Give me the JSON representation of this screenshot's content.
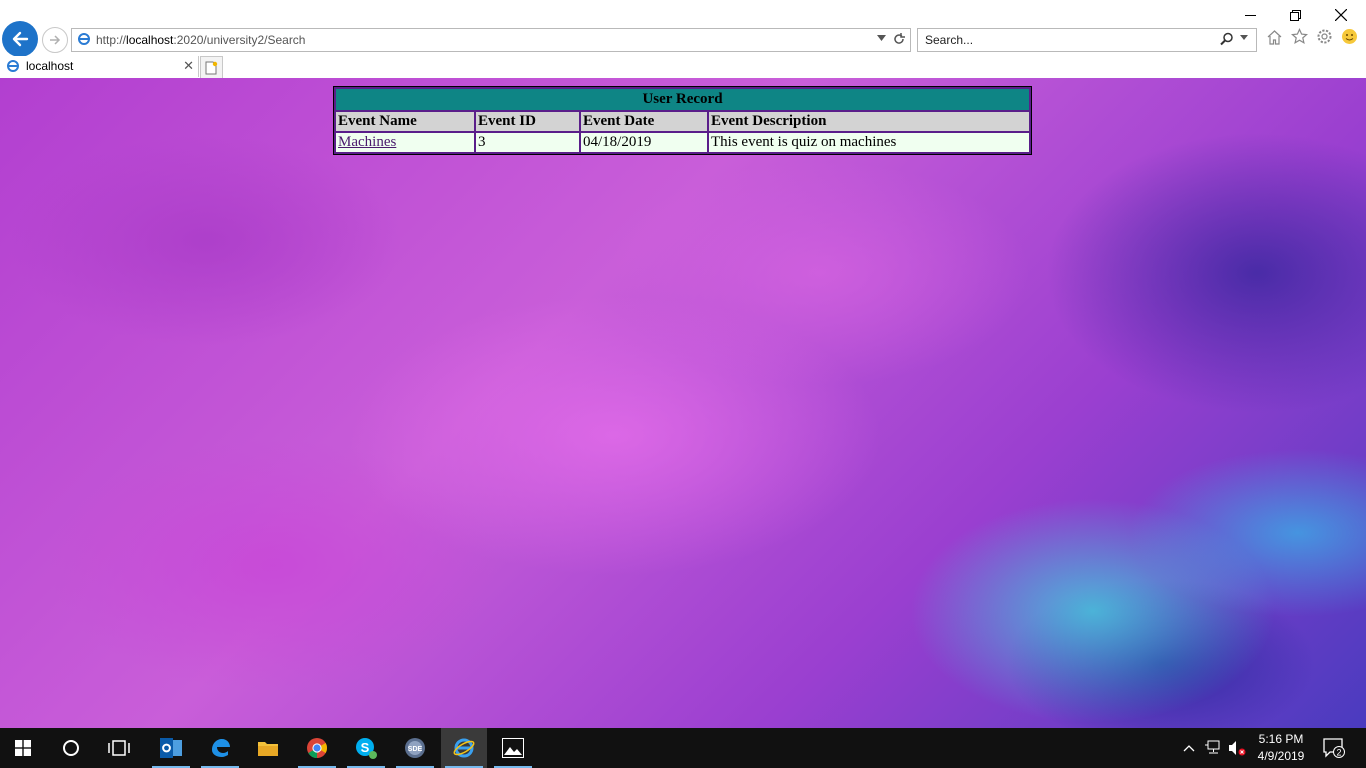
{
  "browser": {
    "url_prefix": "http://",
    "url_host": "localhost",
    "url_rest": ":2020/university2/Search",
    "search_placeholder": "Search...",
    "tab_title": "localhost"
  },
  "table": {
    "caption": "User Record",
    "headers": [
      "Event Name",
      "Event ID",
      "Event Date",
      "Event Description"
    ],
    "rows": [
      {
        "name": "Machines",
        "id": "3",
        "date": "04/18/2019",
        "description": "This event is quiz on machines"
      }
    ]
  },
  "taskbar": {
    "apps": [
      "start-icon",
      "cortana-icon",
      "task-view-icon",
      "outlook-icon",
      "edge-icon",
      "file-explorer-icon",
      "chrome-icon",
      "skype-icon",
      "sde-icon",
      "internet-explorer-icon",
      "photos-icon"
    ],
    "sde_label": "SDE",
    "time": "5:16 PM",
    "date": "4/9/2019",
    "notifications": "2"
  },
  "colors": {
    "caption_bg": "#0e8585",
    "header_bg": "#d3d3d3",
    "row_bg": "#f0fff0",
    "back_button": "#1e73c9"
  }
}
